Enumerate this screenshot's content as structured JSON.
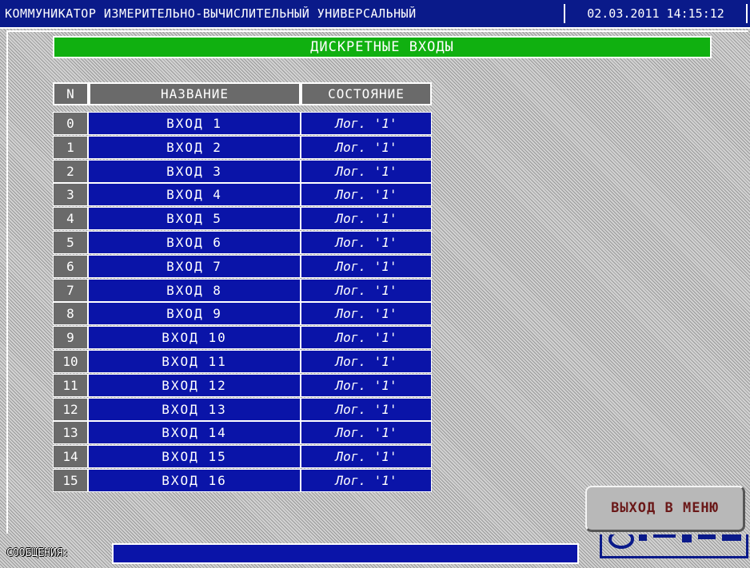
{
  "header": {
    "app_title": "КОММУНИКАТОР ИЗМЕРИТЕЛЬНО-ВЫЧИСЛИТЕЛЬНЫЙ УНИВЕРСАЛЬНЫЙ",
    "datetime": "02.03.2011 14:15:12"
  },
  "screen": {
    "title": "ДИСКРЕТНЫЕ ВХОДЫ"
  },
  "table": {
    "columns": [
      "N",
      "НАЗВАНИЕ",
      "СОСТОЯНИЕ"
    ],
    "rows": [
      {
        "n": "0",
        "name": "ВХОД 1",
        "state": "Лог. '1'"
      },
      {
        "n": "1",
        "name": "ВХОД 2",
        "state": "Лог. '1'"
      },
      {
        "n": "2",
        "name": "ВХОД 3",
        "state": "Лог. '1'"
      },
      {
        "n": "3",
        "name": "ВХОД 4",
        "state": "Лог. '1'"
      },
      {
        "n": "4",
        "name": "ВХОД 5",
        "state": "Лог. '1'"
      },
      {
        "n": "5",
        "name": "ВХОД 6",
        "state": "Лог. '1'"
      },
      {
        "n": "6",
        "name": "ВХОД 7",
        "state": "Лог. '1'"
      },
      {
        "n": "7",
        "name": "ВХОД 8",
        "state": "Лог. '1'"
      },
      {
        "n": "8",
        "name": "ВХОД 9",
        "state": "Лог. '1'"
      },
      {
        "n": "9",
        "name": "ВХОД 10",
        "state": "Лог. '1'"
      },
      {
        "n": "10",
        "name": "ВХОД 11",
        "state": "Лог. '1'"
      },
      {
        "n": "11",
        "name": "ВХОД 12",
        "state": "Лог. '1'"
      },
      {
        "n": "12",
        "name": "ВХОД 13",
        "state": "Лог. '1'"
      },
      {
        "n": "13",
        "name": "ВХОД 14",
        "state": "Лог. '1'"
      },
      {
        "n": "14",
        "name": "ВХОД 15",
        "state": "Лог. '1'"
      },
      {
        "n": "15",
        "name": "ВХОД 16",
        "state": "Лог. '1'"
      }
    ]
  },
  "buttons": {
    "exit_to_menu": "ВЫХОД В МЕНЮ"
  },
  "footer": {
    "messages_label": "СООБЩЕНИЯ:",
    "messages_value": ""
  },
  "colors": {
    "title_bar": "#0a1a8a",
    "header_green": "#10b010",
    "cell_blue": "#0a14a8",
    "index_gray": "#6a6a6a"
  }
}
